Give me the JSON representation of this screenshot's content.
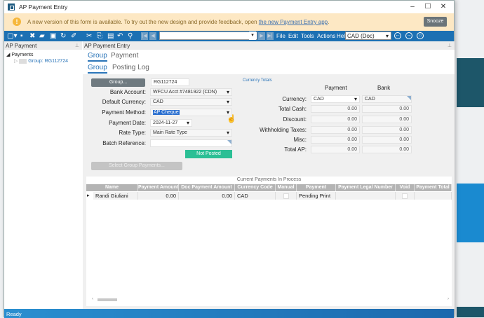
{
  "window": {
    "title": "AP Payment Entry"
  },
  "banner": {
    "message": "A new version of this form is available. To try out the new design and provide feedback, open ",
    "link": "the new Payment Entry app",
    "link_suffix": ".",
    "snooze": "Snooze"
  },
  "toolbar": {
    "menus": [
      "File",
      "Edit",
      "Tools",
      "Actions",
      "Help"
    ],
    "currency": "CAD (Doc)"
  },
  "left_panel": {
    "title": "AP Payment",
    "tree_root": "Payments",
    "tree_child": "Group: RG112724"
  },
  "main": {
    "title": "AP Payment Entry",
    "tabs": [
      "Group",
      "Payment"
    ],
    "subtabs": [
      "Group",
      "Posting Log"
    ]
  },
  "form": {
    "group_button": "Group...",
    "group_id": "RG112724",
    "bank_account_label": "Bank Account:",
    "bank_account": "WFCU Acct #7481922 (CDN)",
    "default_currency_label": "Default Currency:",
    "default_currency": "CAD",
    "payment_method_label": "Payment Method:",
    "payment_method": "AP Cheque",
    "payment_date_label": "Payment Date:",
    "payment_date": "2024-11-27",
    "rate_type_label": "Rate Type:",
    "rate_type": "Main Rate Type",
    "batch_reference_label": "Batch Reference:",
    "batch_reference": "",
    "status": "Not Posted",
    "select_group_payments": "Select Group Payments..."
  },
  "totals": {
    "title": "Currency Totals",
    "col_payment": "Payment",
    "col_bank": "Bank",
    "rows": [
      {
        "label": "Currency:",
        "payment": "CAD",
        "bank": "CAD"
      },
      {
        "label": "Total Cash:",
        "payment": "0.00",
        "bank": "0.00"
      },
      {
        "label": "Discount:",
        "payment": "0.00",
        "bank": "0.00"
      },
      {
        "label": "Withholding Taxes:",
        "payment": "0.00",
        "bank": "0.00"
      },
      {
        "label": "Misc:",
        "payment": "0.00",
        "bank": "0.00"
      },
      {
        "label": "Total AP:",
        "payment": "0.00",
        "bank": "0.00"
      }
    ]
  },
  "grid": {
    "title": "Current Payments In Process",
    "columns": [
      "Name",
      "Payment Amount",
      "Doc Payment Amount",
      "Currency Code",
      "Manual",
      "Payment",
      "Payment Legal Number",
      "Void",
      "Payment Total"
    ],
    "rows": [
      {
        "name": "Randi Giuliani",
        "payment_amount": "0.00",
        "doc_payment_amount": "0.00",
        "currency_code": "CAD",
        "manual": false,
        "payment": "Pending Print",
        "payment_legal_number": "",
        "void": false,
        "payment_total": ""
      }
    ]
  },
  "status_bar": {
    "text": "Ready"
  },
  "colors": {
    "toolbar": "#1c70b3",
    "accent": "#2a74b8",
    "not_posted": "#2bbf95",
    "banner": "#fde8c4"
  }
}
